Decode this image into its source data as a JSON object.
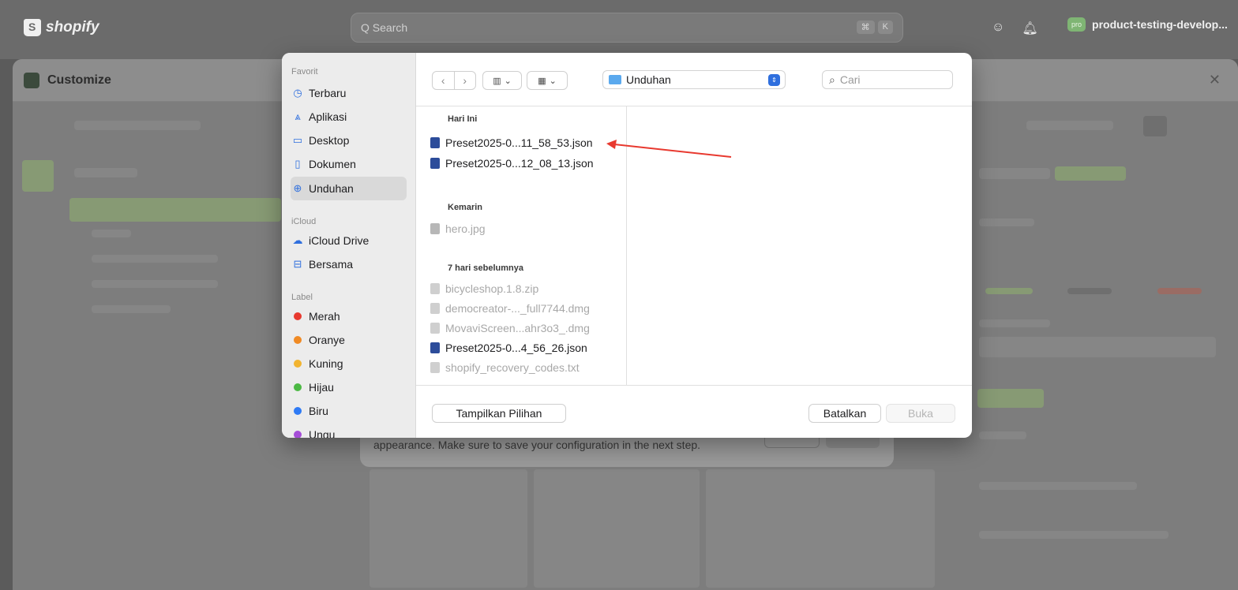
{
  "topbar": {
    "brand": "shopify",
    "search_placeholder": "Q Search",
    "shortcut_keys": [
      "⌘",
      "K"
    ],
    "store_badge": "pro",
    "store_name": "product-testing-develop..."
  },
  "customize": {
    "title": "Customize"
  },
  "underlying_dialog": {
    "description": "appearance. Make sure to save your configuration in the next step."
  },
  "file_dialog": {
    "sidebar": {
      "favorites_label": "Favorit",
      "favorites": [
        {
          "label": "Terbaru",
          "icon": "clock-icon"
        },
        {
          "label": "Aplikasi",
          "icon": "apps-icon"
        },
        {
          "label": "Desktop",
          "icon": "desktop-icon"
        },
        {
          "label": "Dokumen",
          "icon": "document-icon"
        },
        {
          "label": "Unduhan",
          "icon": "download-icon",
          "selected": true
        }
      ],
      "icloud_label": "iCloud",
      "icloud": [
        {
          "label": "iCloud Drive",
          "icon": "cloud-icon"
        },
        {
          "label": "Bersama",
          "icon": "shared-folder-icon"
        }
      ],
      "tags_label": "Label",
      "tags": [
        {
          "label": "Merah",
          "color": "#e8392f"
        },
        {
          "label": "Oranye",
          "color": "#f08a24"
        },
        {
          "label": "Kuning",
          "color": "#f2b430"
        },
        {
          "label": "Hijau",
          "color": "#4cb944"
        },
        {
          "label": "Biru",
          "color": "#2f7bf5"
        },
        {
          "label": "Ungu",
          "color": "#a64ed8"
        }
      ]
    },
    "toolbar": {
      "location": "Unduhan",
      "search_placeholder": "Cari"
    },
    "groups": [
      {
        "label": "Hari Ini",
        "files": [
          {
            "name": "Preset2025-0...11_58_53.json",
            "enabled": true
          },
          {
            "name": "Preset2025-0...12_08_13.json",
            "enabled": true
          }
        ]
      },
      {
        "label": "Kemarin",
        "files": [
          {
            "name": "hero.jpg",
            "enabled": false
          }
        ]
      },
      {
        "label": "7 hari sebelumnya",
        "files": [
          {
            "name": "bicycleshop.1.8.zip",
            "enabled": false
          },
          {
            "name": "democreator-..._full7744.dmg",
            "enabled": false
          },
          {
            "name": "MovaviScreen...ahr3o3_.dmg",
            "enabled": false
          },
          {
            "name": "Preset2025-0...4_56_26.json",
            "enabled": true
          },
          {
            "name": "shopify_recovery_codes.txt",
            "enabled": false
          }
        ]
      }
    ],
    "footer": {
      "options_label": "Tampilkan Pilihan",
      "cancel_label": "Batalkan",
      "open_label": "Buka"
    }
  },
  "annotation": {
    "arrow_color": "#e8392f"
  }
}
